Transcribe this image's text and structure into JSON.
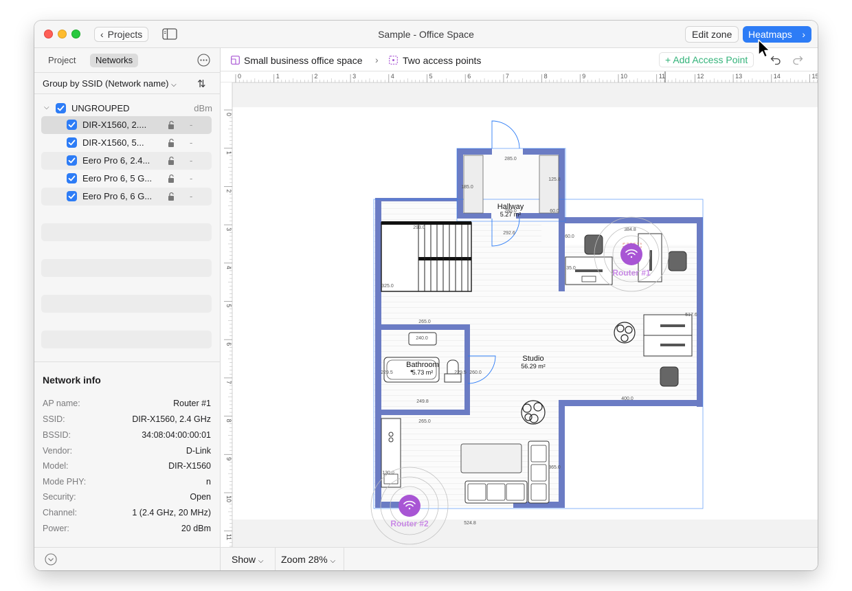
{
  "window": {
    "title": "Sample - Office Space",
    "back_label": "Projects",
    "edit_zone_label": "Edit zone",
    "heatmaps_label": "Heatmaps"
  },
  "sidebar": {
    "tabs": [
      "Project",
      "Networks"
    ],
    "active_tab": "Networks",
    "group_by_label": "Group by SSID (Network name)",
    "group": {
      "label": "UNGROUPED",
      "unit": "dBm"
    },
    "networks": [
      {
        "name": "DIR-X1560, 2....",
        "value": "-",
        "selected": true
      },
      {
        "name": "DIR-X1560, 5...",
        "value": "-",
        "selected": false
      },
      {
        "name": "Eero Pro 6, 2.4...",
        "value": "-",
        "selected": false
      },
      {
        "name": "Eero Pro 6, 5 G...",
        "value": "-",
        "selected": false
      },
      {
        "name": "Eero Pro 6, 6 G...",
        "value": "-",
        "selected": false
      }
    ]
  },
  "network_info": {
    "title": "Network info",
    "rows": [
      {
        "key": "AP name:",
        "value": "Router #1"
      },
      {
        "key": "SSID:",
        "value": "DIR-X1560, 2.4 GHz"
      },
      {
        "key": "BSSID:",
        "value": "34:08:04:00:00:01"
      },
      {
        "key": "Vendor:",
        "value": "D-Link"
      },
      {
        "key": "Model:",
        "value": "DIR-X1560"
      },
      {
        "key": "Mode PHY:",
        "value": "n"
      },
      {
        "key": "Security:",
        "value": "Open"
      },
      {
        "key": "Channel:",
        "value": "1 (2.4 GHz, 20 MHz)"
      },
      {
        "key": "Power:",
        "value": "20 dBm"
      }
    ]
  },
  "breadcrumb": {
    "project": "Small business office space",
    "zone": "Two access points",
    "add_ap_label": "Add Access Point"
  },
  "ruler": {
    "top_ticks": [
      "0",
      "1",
      "2",
      "3",
      "4",
      "5",
      "6",
      "7",
      "8",
      "9",
      "10",
      "11",
      "12",
      "13",
      "14",
      "15"
    ],
    "left_ticks": [
      "0",
      "1",
      "2",
      "3",
      "4",
      "5",
      "6",
      "7",
      "8",
      "9",
      "10",
      "11"
    ]
  },
  "floorplan": {
    "rooms": [
      {
        "name": "Hallway",
        "area": "5.27 m²"
      },
      {
        "name": "Bathroom",
        "area": "5.73 m²"
      },
      {
        "name": "Studio",
        "area": "56.29 m²"
      }
    ],
    "dimensions": [
      "285.0",
      "185.0",
      "125.8",
      "285.0",
      "60.0",
      "292.6",
      "60.0",
      "384.8",
      "35.0",
      "293.0",
      "325.0",
      "265.0",
      "240.0",
      "229.5",
      "229.5",
      "260.0",
      "249.8",
      "265.0",
      "517.6",
      "400.0",
      "130.0",
      "365.0",
      "524.8"
    ],
    "routers": [
      {
        "name": "Router #1"
      },
      {
        "name": "Router #2"
      }
    ],
    "colors": {
      "router": "#a855d4",
      "wall": "#6b7cc4",
      "selection": "#2d7cf6"
    }
  },
  "statusbar": {
    "show_label": "Show",
    "zoom_label": "Zoom 28%"
  },
  "colors": {
    "accent": "#2d7cf6",
    "add_green": "#34b37a"
  }
}
